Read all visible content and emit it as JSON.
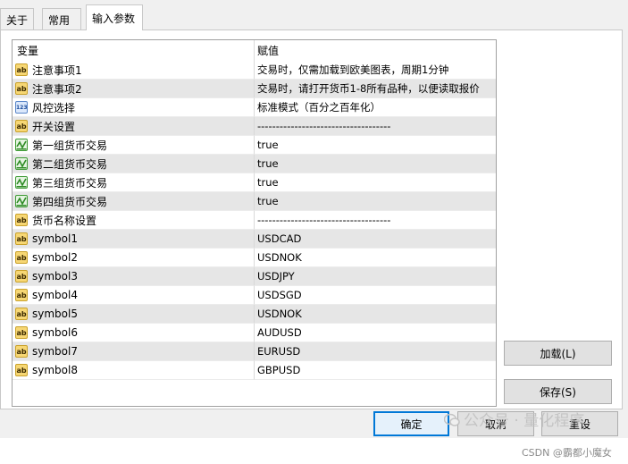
{
  "tabs": [
    {
      "label": "关于",
      "active": false
    },
    {
      "label": "常用",
      "active": false
    },
    {
      "label": "输入参数",
      "active": true
    }
  ],
  "grid": {
    "header": {
      "variable": "变量",
      "value": "赋值"
    },
    "rows": [
      {
        "icon": "ab-string-icon",
        "name": "注意事项1",
        "value": "交易时，仅需加载到欧美图表，周期1分钟"
      },
      {
        "icon": "ab-string-icon",
        "name": "注意事项2",
        "value": "交易时，请打开货币1-8所有品种，以便读取报价"
      },
      {
        "icon": "123-enum-icon",
        "name": "风控选择",
        "value": "标准模式（百分之百年化）"
      },
      {
        "icon": "ab-string-icon",
        "name": "开关设置",
        "value": "------------------------------------"
      },
      {
        "icon": "bool-check-icon",
        "name": "第一组货币交易",
        "value": "true"
      },
      {
        "icon": "bool-check-icon",
        "name": "第二组货币交易",
        "value": "true"
      },
      {
        "icon": "bool-check-icon",
        "name": "第三组货币交易",
        "value": "true"
      },
      {
        "icon": "bool-check-icon",
        "name": "第四组货币交易",
        "value": "true"
      },
      {
        "icon": "ab-string-icon",
        "name": "货币名称设置",
        "value": "------------------------------------"
      },
      {
        "icon": "ab-string-icon",
        "name": "symbol1",
        "value": "USDCAD"
      },
      {
        "icon": "ab-string-icon",
        "name": "symbol2",
        "value": "USDNOK"
      },
      {
        "icon": "ab-string-icon",
        "name": "symbol3",
        "value": "USDJPY"
      },
      {
        "icon": "ab-string-icon",
        "name": "symbol4",
        "value": "USDSGD"
      },
      {
        "icon": "ab-string-icon",
        "name": "symbol5",
        "value": "USDNOK"
      },
      {
        "icon": "ab-string-icon",
        "name": "symbol6",
        "value": "AUDUSD"
      },
      {
        "icon": "ab-string-icon",
        "name": "symbol7",
        "value": "EURUSD"
      },
      {
        "icon": "ab-string-icon",
        "name": "symbol8",
        "value": "GBPUSD"
      }
    ]
  },
  "buttons": {
    "load": "加载(L)",
    "save": "保存(S)",
    "ok": "确定",
    "cancel": "取消",
    "reset": "重设"
  },
  "icon_glyphs": {
    "ab": "ab",
    "num": "123"
  },
  "watermark": {
    "wechat": "公众号 · 量化程序",
    "csdn": "CSDN @霸都小魔女"
  },
  "colors": {
    "dialog_bg": "#f0f0f0",
    "row_alt": "#e6e6e6",
    "primary_border": "#0078d7"
  }
}
